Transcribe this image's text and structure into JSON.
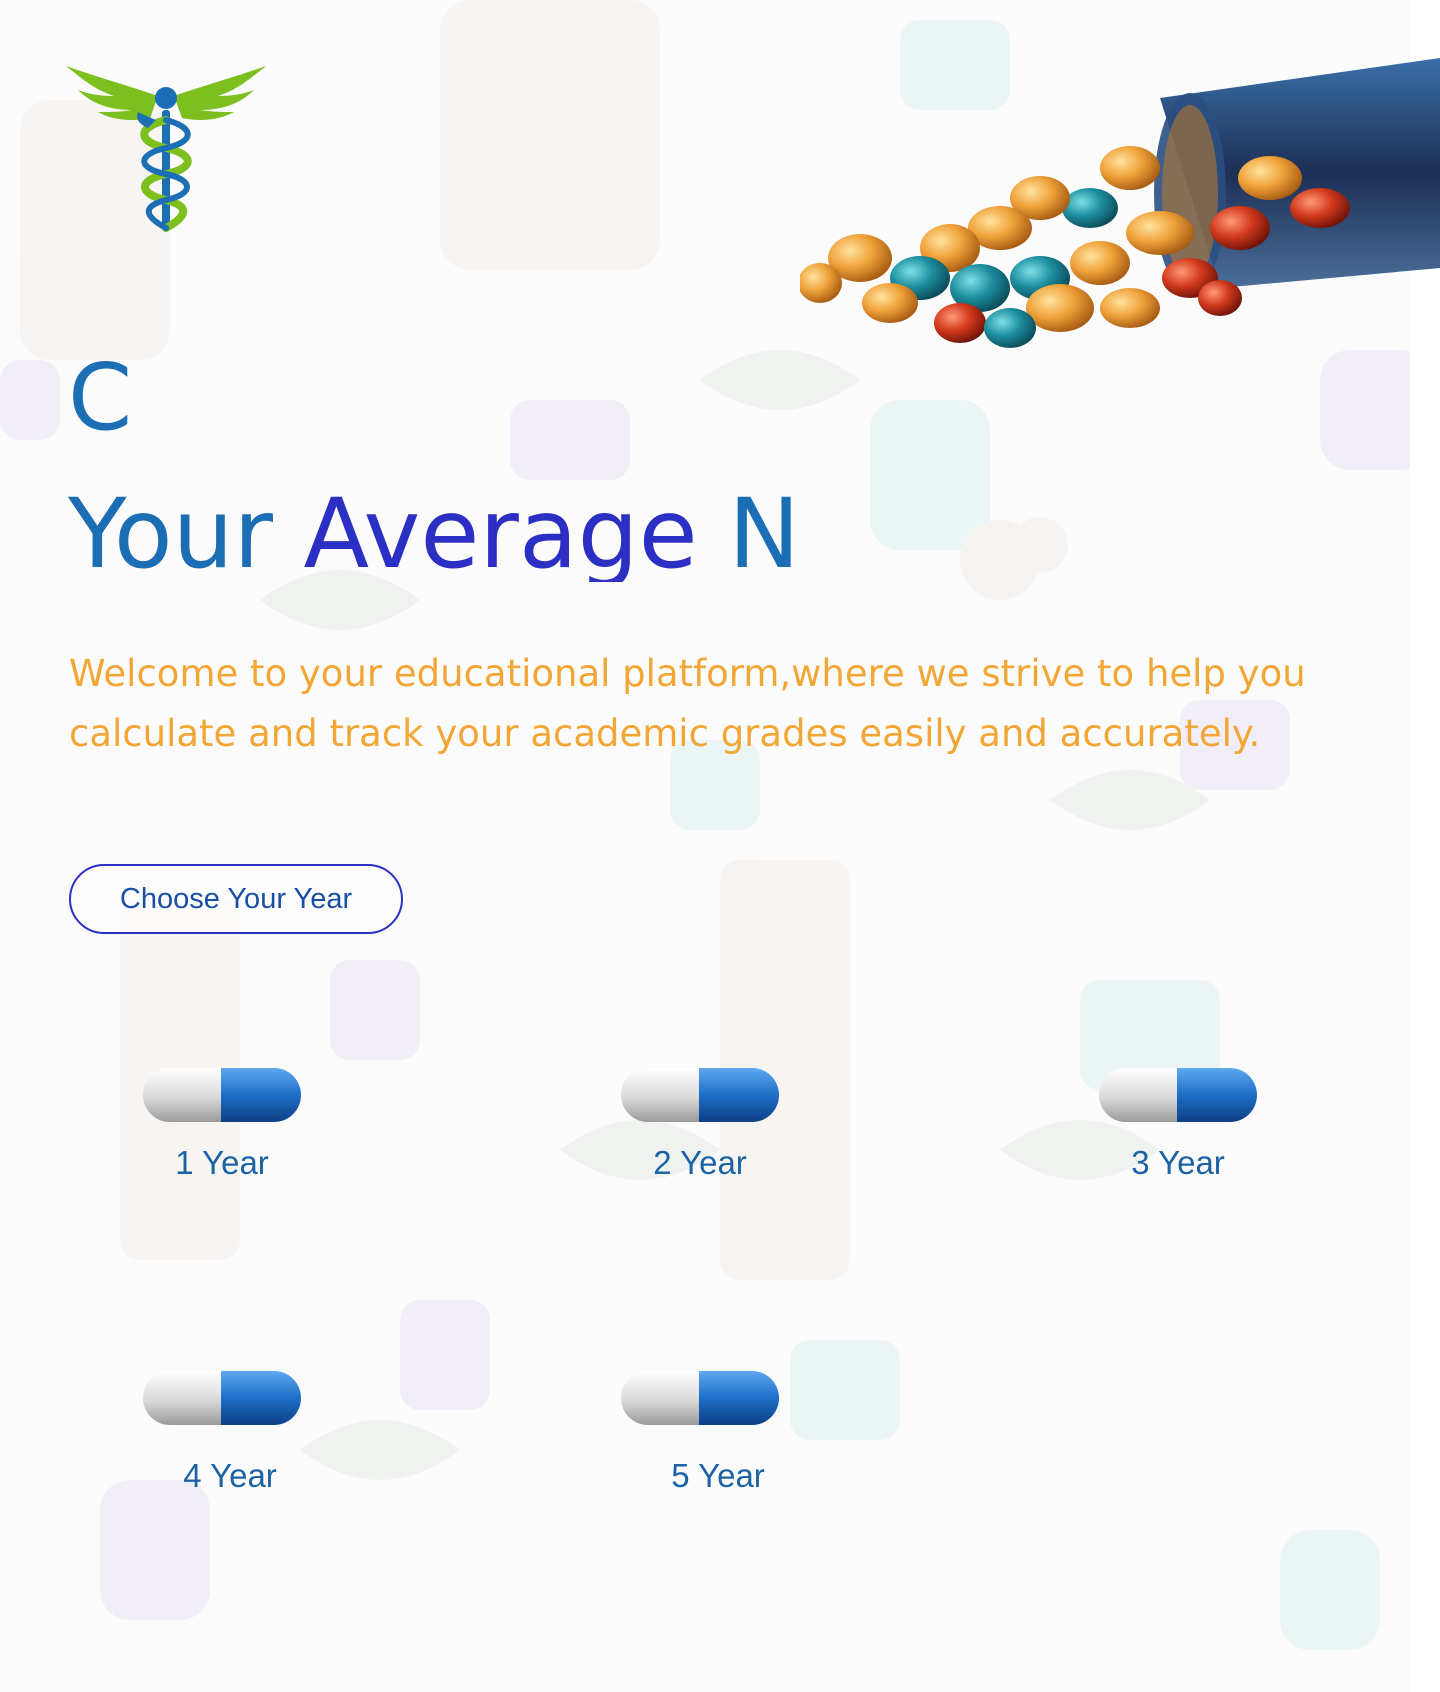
{
  "hero": {
    "typed_line_1": "C",
    "typed_line_2_part1": "Your ",
    "typed_line_2_accent": "Average",
    "typed_line_2_part2": " N",
    "description": "Welcome to your educational platform,where we strive to help you calculate and track your academic grades easily and accurately."
  },
  "actions": {
    "choose_year_label": "Choose Your Year"
  },
  "years": [
    {
      "label": "1 Year"
    },
    {
      "label": "2 Year"
    },
    {
      "label": "3 Year"
    },
    {
      "label": "4 Year"
    },
    {
      "label": "5 Year"
    }
  ],
  "icons": {
    "logo": "caduceus-logo-icon",
    "hero_image": "pill-bottle-icon",
    "year_icon": "capsule-icon"
  },
  "colors": {
    "heading_blue": "#1b6db4",
    "heading_accent": "#2c2fc4",
    "description_orange": "#f2a636",
    "capsule_blue": "#1e6fc8",
    "logo_green": "#7cbf1e"
  }
}
